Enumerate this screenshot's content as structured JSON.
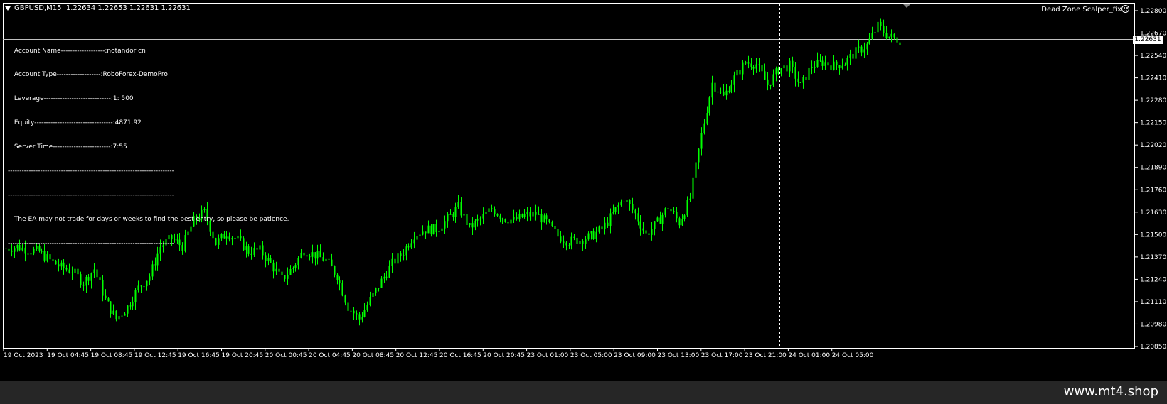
{
  "header": {
    "symbol_line": "GBPUSD,M15  1.22634 1.22653 1.22631 1.22631",
    "ea_name": "Dead Zone Scalper_fix"
  },
  "info_panel": {
    "lines": [
      ":: Account Name-------------------:notandor cn",
      ":: Account Type-------------------:RoboForex-DemoPro",
      ":: Leverage-----------------------------:1: 500",
      ":: Equity----------------------------------:4871.92",
      ":: Server Time-------------------------:7:55",
      "------------------------------------------------------------------------",
      "------------------------------------------------------------------------",
      ":: The EA may not trade for days or weeks to find the best entry, so please be patience.",
      "------------------------------------------------------------------------"
    ]
  },
  "current_price": "1.22631",
  "watermark": "www.mt4.shop",
  "colors": {
    "background": "#000000",
    "candle": "#00ff00",
    "grid": "#ffffff",
    "text": "#ffffff",
    "footer": "#262626"
  },
  "chart_data": {
    "type": "candlestick",
    "symbol": "GBPUSD",
    "timeframe": "M15",
    "ohlc_last": {
      "open": 1.22634,
      "high": 1.22653,
      "low": 1.22631,
      "close": 1.22631
    },
    "y_ticks": [
      "1.22800",
      "1.22670",
      "1.22540",
      "1.22410",
      "1.22280",
      "1.22150",
      "1.22020",
      "1.21890",
      "1.21760",
      "1.21630",
      "1.21500",
      "1.21370",
      "1.21240",
      "1.21110",
      "1.20980",
      "1.20850"
    ],
    "ylim": [
      1.2085,
      1.228
    ],
    "x_ticks": [
      "19 Oct 2023",
      "19 Oct 04:45",
      "19 Oct 08:45",
      "19 Oct 12:45",
      "19 Oct 16:45",
      "19 Oct 20:45",
      "20 Oct 00:45",
      "20 Oct 04:45",
      "20 Oct 08:45",
      "20 Oct 12:45",
      "20 Oct 16:45",
      "20 Oct 20:45",
      "23 Oct 01:00",
      "23 Oct 05:00",
      "23 Oct 09:00",
      "23 Oct 13:00",
      "23 Oct 17:00",
      "23 Oct 21:00",
      "24 Oct 01:00",
      "24 Oct 05:00"
    ],
    "day_separators_after_tick": [
      "19 Oct 20:45",
      "20 Oct 20:45",
      "23 Oct 21:00"
    ],
    "close_path": [
      [
        0,
        1.2142
      ],
      [
        4,
        1.2143
      ],
      [
        8,
        1.2141
      ],
      [
        12,
        1.214
      ],
      [
        16,
        1.2135
      ],
      [
        20,
        1.2131
      ],
      [
        24,
        1.2129
      ],
      [
        28,
        1.2122
      ],
      [
        32,
        1.213
      ],
      [
        36,
        1.2112
      ],
      [
        40,
        1.2101
      ],
      [
        44,
        1.2108
      ],
      [
        48,
        1.2119
      ],
      [
        52,
        1.2126
      ],
      [
        56,
        1.2143
      ],
      [
        60,
        1.2148
      ],
      [
        64,
        1.2143
      ],
      [
        68,
        1.2158
      ],
      [
        72,
        1.2163
      ],
      [
        76,
        1.2145
      ],
      [
        80,
        1.2151
      ],
      [
        84,
        1.2147
      ],
      [
        88,
        1.214
      ],
      [
        92,
        1.2141
      ],
      [
        96,
        1.2133
      ],
      [
        100,
        1.2124
      ],
      [
        104,
        1.2131
      ],
      [
        108,
        1.2141
      ],
      [
        112,
        1.2138
      ],
      [
        116,
        1.2135
      ],
      [
        120,
        1.2126
      ],
      [
        124,
        1.2108
      ],
      [
        128,
        1.2101
      ],
      [
        132,
        1.2112
      ],
      [
        136,
        1.2123
      ],
      [
        140,
        1.2133
      ],
      [
        144,
        1.214
      ],
      [
        148,
        1.215
      ],
      [
        152,
        1.2153
      ],
      [
        156,
        1.2153
      ],
      [
        160,
        1.2159
      ],
      [
        164,
        1.2166
      ],
      [
        168,
        1.2154
      ],
      [
        172,
        1.2159
      ],
      [
        176,
        1.2165
      ],
      [
        180,
        1.216
      ],
      [
        184,
        1.2158
      ],
      [
        188,
        1.2161
      ],
      [
        192,
        1.2162
      ],
      [
        196,
        1.2157
      ],
      [
        200,
        1.2149
      ],
      [
        204,
        1.2146
      ],
      [
        208,
        1.2147
      ],
      [
        212,
        1.2149
      ],
      [
        216,
        1.2153
      ],
      [
        220,
        1.2162
      ],
      [
        224,
        1.2171
      ],
      [
        228,
        1.2162
      ],
      [
        232,
        1.215
      ],
      [
        236,
        1.2157
      ],
      [
        240,
        1.2166
      ],
      [
        244,
        1.2157
      ],
      [
        248,
        1.2171
      ],
      [
        252,
        1.2208
      ],
      [
        256,
        1.2238
      ],
      [
        260,
        1.223
      ],
      [
        264,
        1.2241
      ],
      [
        268,
        1.225
      ],
      [
        272,
        1.2249
      ],
      [
        276,
        1.2237
      ],
      [
        280,
        1.2246
      ],
      [
        284,
        1.2248
      ],
      [
        288,
        1.2236
      ],
      [
        292,
        1.2248
      ],
      [
        296,
        1.225
      ],
      [
        300,
        1.2248
      ],
      [
        304,
        1.225
      ],
      [
        308,
        1.2256
      ],
      [
        312,
        1.226
      ],
      [
        316,
        1.2271
      ],
      [
        320,
        1.2265
      ],
      [
        324,
        1.2263
      ]
    ]
  }
}
